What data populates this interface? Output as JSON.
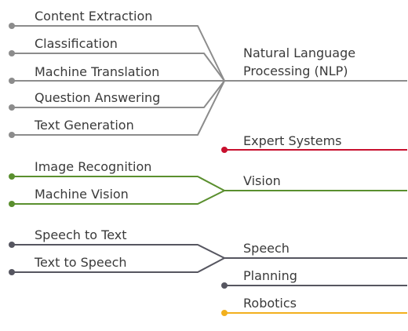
{
  "colors": {
    "nlp": "#8c8c8c",
    "expert": "#c8102e",
    "vision": "#5a8f2e",
    "speech": "#565660",
    "planning": "#565660",
    "robotics": "#f2b01e",
    "text": "#3a3a3a"
  },
  "nlp": {
    "label_line1": "Natural Language",
    "label_line2": "Processing (NLP)",
    "items": [
      "Content Extraction",
      "Classification",
      "Machine Translation",
      "Question Answering",
      "Text Generation"
    ]
  },
  "expert_systems": {
    "label": "Expert Systems"
  },
  "vision": {
    "label": "Vision",
    "items": [
      "Image Recognition",
      "Machine Vision"
    ]
  },
  "speech": {
    "label": "Speech",
    "items": [
      "Speech to Text",
      "Text to Speech"
    ]
  },
  "planning": {
    "label": "Planning"
  },
  "robotics": {
    "label": "Robotics"
  }
}
